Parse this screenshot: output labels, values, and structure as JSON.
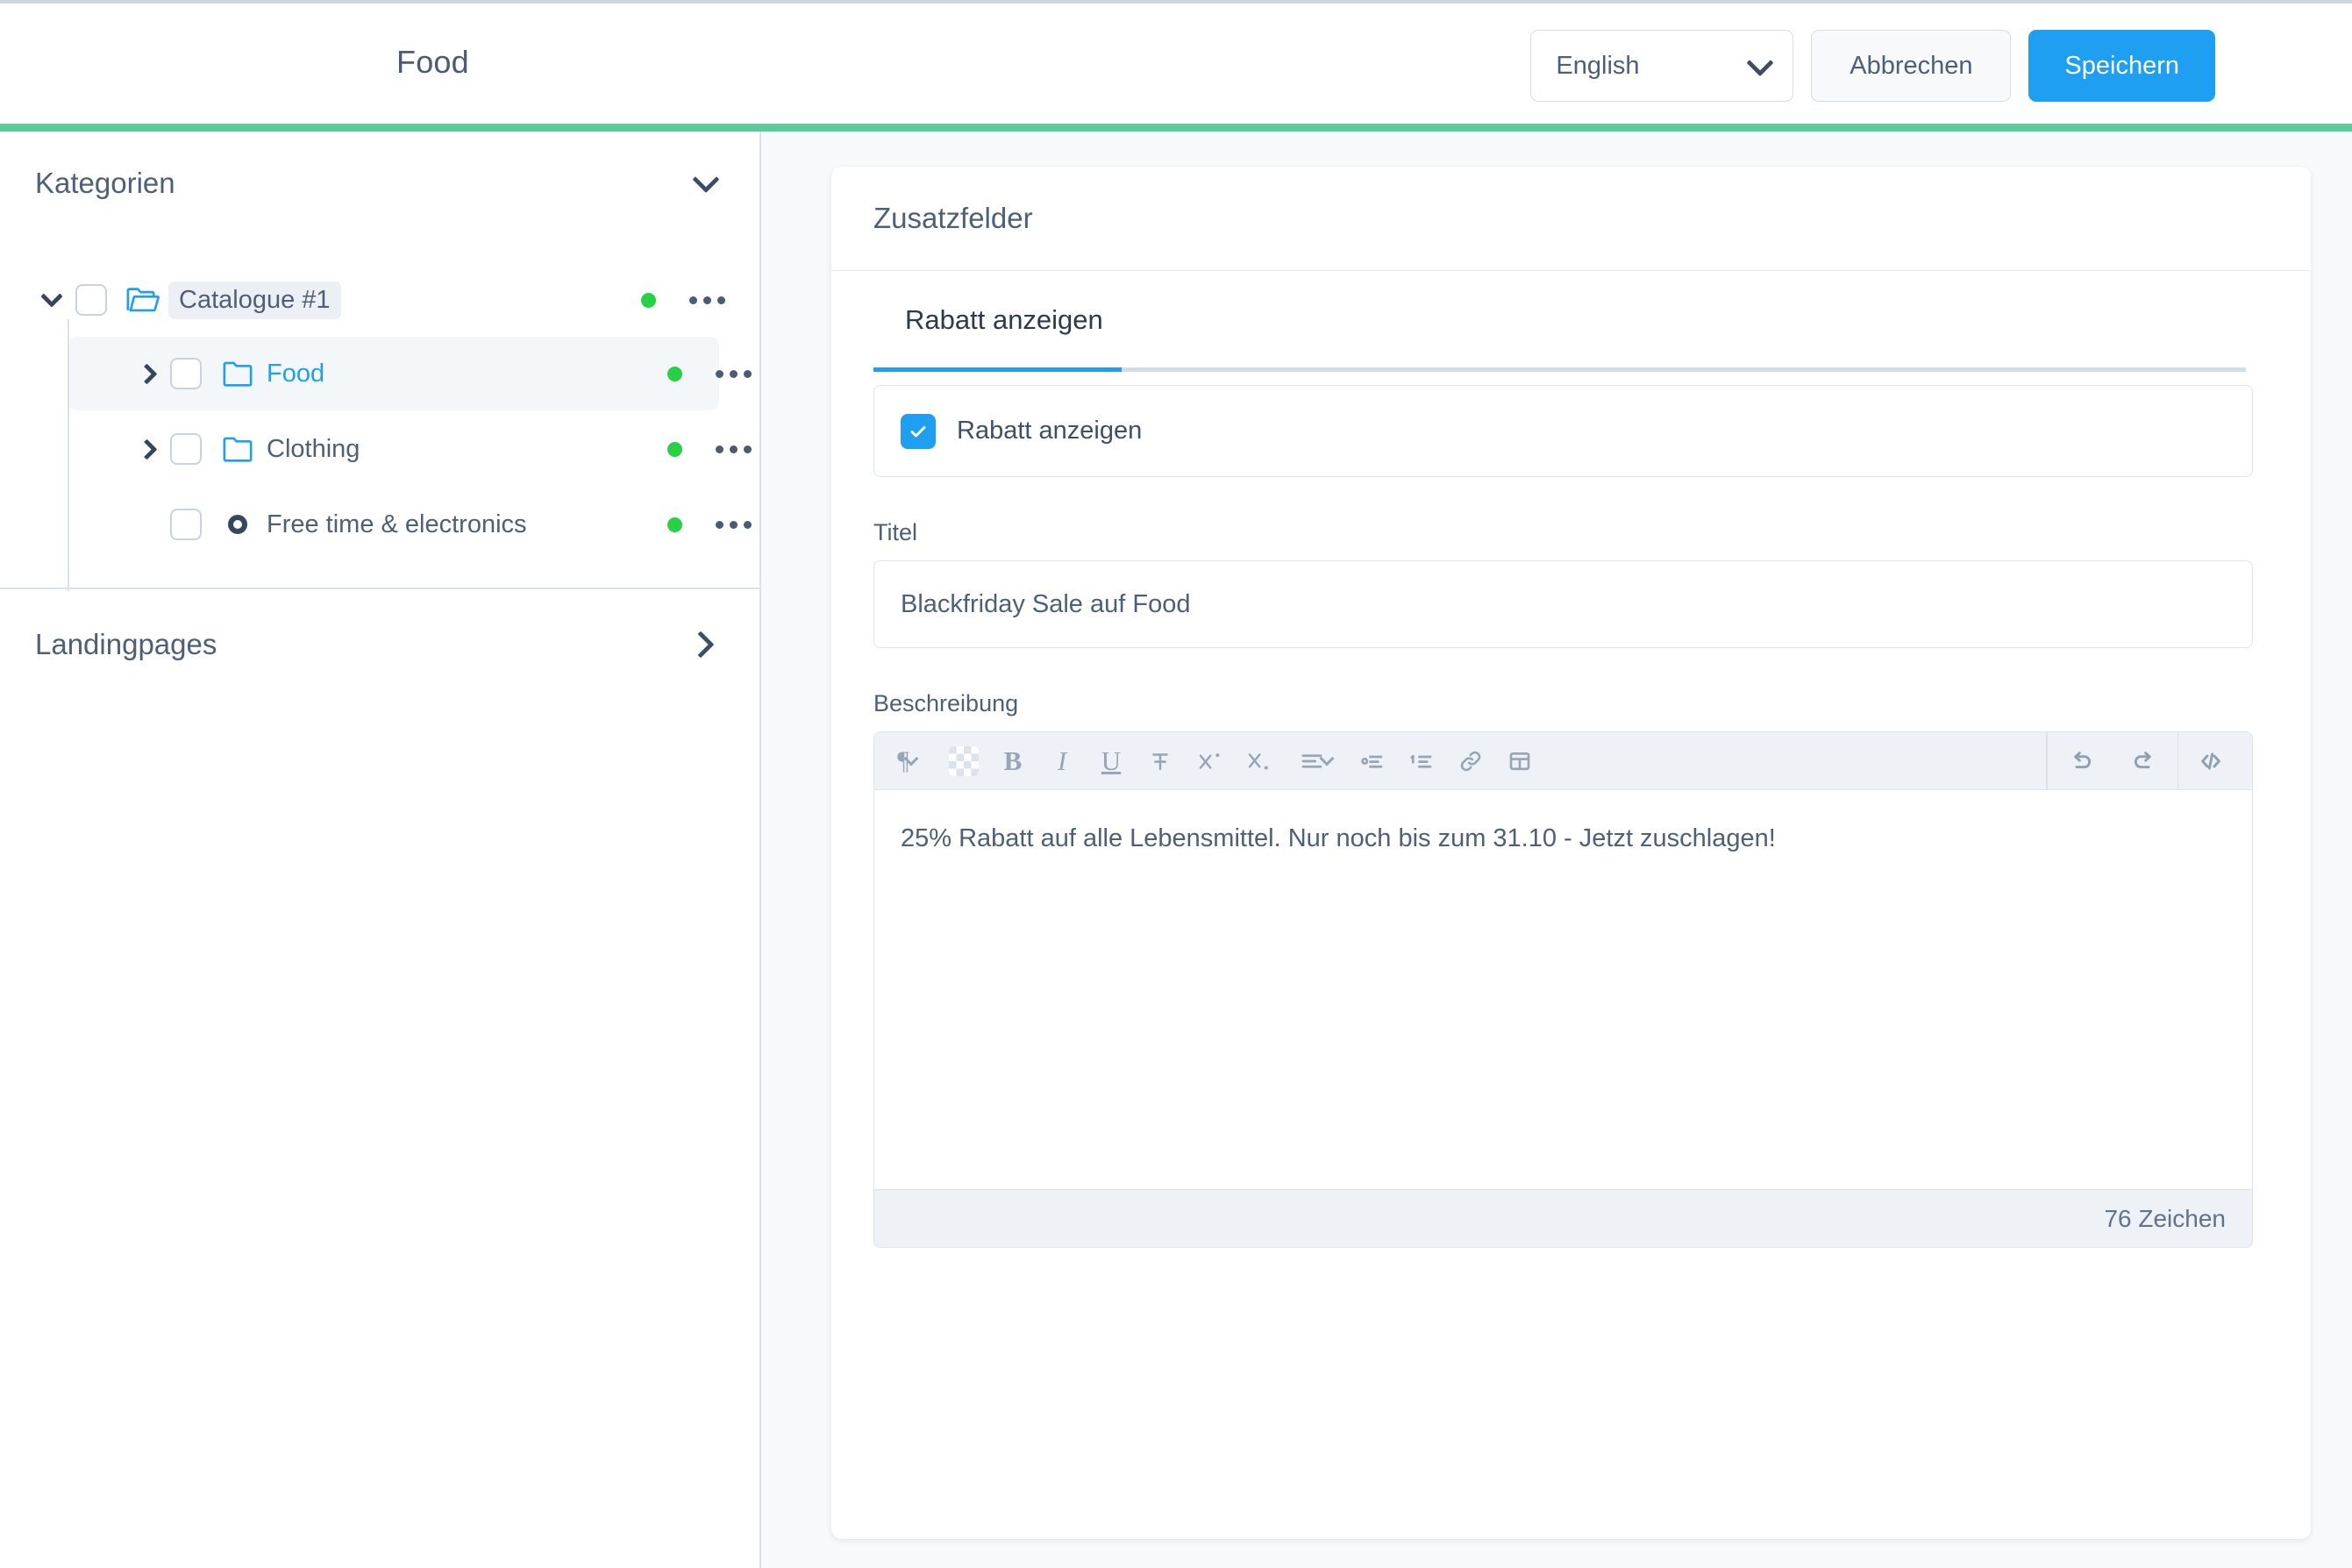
{
  "header": {
    "title": "Food",
    "language_select": {
      "value": "English",
      "icon": "chevron-down-icon"
    },
    "cancel_label": "Abbrechen",
    "save_label": "Speichern",
    "accent_color": "#5ccb9c",
    "primary_color": "#1e9ff2"
  },
  "sidebar": {
    "sections": [
      {
        "title": "Kategorien",
        "caret": "chevron-down-icon",
        "expanded": true
      },
      {
        "title": "Landingpages",
        "caret": "chevron-right-icon",
        "expanded": false
      }
    ],
    "tree": [
      {
        "label": "Catalogue #1",
        "depth": 0,
        "expander": "chevron-down-icon",
        "icon": "folder-open-icon",
        "selected": false,
        "highlighted": true,
        "label_color": "#4e5f77",
        "status_color": "#27d045",
        "menu": "kebab-menu-icon"
      },
      {
        "label": "Food",
        "depth": 1,
        "expander": "chevron-right-icon",
        "icon": "folder-icon",
        "selected": true,
        "highlighted": false,
        "label_color": "#1e9ff2",
        "status_color": "#27d045",
        "menu": "kebab-menu-icon"
      },
      {
        "label": "Clothing",
        "depth": 1,
        "expander": "chevron-right-icon",
        "icon": "folder-icon",
        "selected": false,
        "highlighted": false,
        "label_color": "#4e5f77",
        "status_color": "#27d045",
        "menu": "kebab-menu-icon"
      },
      {
        "label": "Free time & electronics",
        "depth": 1,
        "expander": "none",
        "icon": "circle-ring-icon",
        "selected": false,
        "highlighted": false,
        "label_color": "#4e5f77",
        "status_color": "#27d045",
        "menu": "kebab-menu-icon"
      }
    ]
  },
  "main": {
    "card_title": "Zusatzfelder",
    "tabs": [
      {
        "label": "Rabatt anzeigen",
        "active": true
      }
    ],
    "checkbox": {
      "label": "Rabatt anzeigen",
      "checked": true
    },
    "title_field": {
      "label": "Titel",
      "value": "Blackfriday Sale auf Food",
      "placeholder": "Titel"
    },
    "description_field": {
      "label": "Beschreibung",
      "content": "25% Rabatt auf alle Lebensmittel. Nur noch bis zum 31.10 - Jetzt zuschlagen!",
      "char_count_label": "76 Zeichen"
    },
    "toolbar": {
      "left_buttons": [
        {
          "name": "paragraph-format-icon",
          "glyph": "¶",
          "has_chevron": true
        },
        {
          "name": "text-color-icon",
          "glyph": "",
          "has_chevron": false
        },
        {
          "name": "bold-icon",
          "glyph": "B",
          "has_chevron": false
        },
        {
          "name": "italic-icon",
          "glyph": "I",
          "has_chevron": false
        },
        {
          "name": "underline-icon",
          "glyph": "U",
          "has_chevron": false
        },
        {
          "name": "strikethrough-icon",
          "glyph": "T",
          "has_chevron": false
        },
        {
          "name": "superscript-icon",
          "glyph": "X",
          "has_chevron": false
        },
        {
          "name": "subscript-icon",
          "glyph": "X",
          "has_chevron": false
        },
        {
          "name": "align-icon",
          "glyph": "",
          "has_chevron": true
        },
        {
          "name": "bulleted-list-icon",
          "glyph": "",
          "has_chevron": false
        },
        {
          "name": "numbered-list-icon",
          "glyph": "",
          "has_chevron": false
        },
        {
          "name": "link-icon",
          "glyph": "",
          "has_chevron": false
        },
        {
          "name": "table-icon",
          "glyph": "",
          "has_chevron": false
        }
      ],
      "right_buttons": [
        {
          "name": "undo-icon"
        },
        {
          "name": "redo-icon"
        },
        {
          "name": "code-view-icon"
        }
      ]
    }
  }
}
